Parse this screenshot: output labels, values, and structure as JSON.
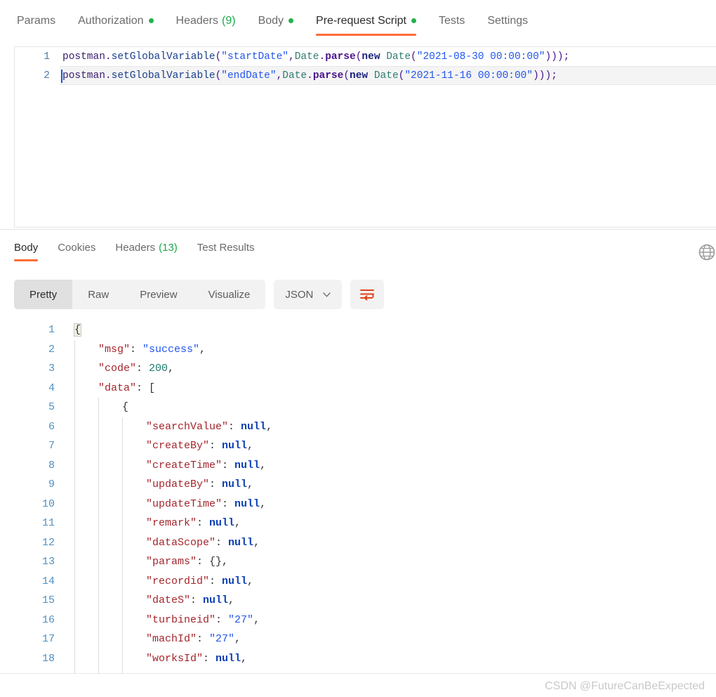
{
  "request_tabs": [
    {
      "label": "Params",
      "active": false,
      "dot": false,
      "count": null
    },
    {
      "label": "Authorization",
      "active": false,
      "dot": true,
      "count": null
    },
    {
      "label": "Headers",
      "active": false,
      "dot": false,
      "count": "(9)"
    },
    {
      "label": "Body",
      "active": false,
      "dot": true,
      "count": null
    },
    {
      "label": "Pre-request Script",
      "active": true,
      "dot": true,
      "count": null
    },
    {
      "label": "Tests",
      "active": false,
      "dot": false,
      "count": null
    },
    {
      "label": "Settings",
      "active": false,
      "dot": false,
      "count": null
    }
  ],
  "editor": {
    "lines": [
      {
        "number": "1",
        "active": false,
        "tokens": [
          {
            "t": "postman",
            "c": "js-obj"
          },
          {
            "t": ".",
            "c": "js-punct"
          },
          {
            "t": "setGlobalVariable",
            "c": "js-prop"
          },
          {
            "t": "(",
            "c": "js-punct"
          },
          {
            "t": "\"startDate\"",
            "c": "js-str"
          },
          {
            "t": ",",
            "c": "js-punct"
          },
          {
            "t": "Date",
            "c": "js-cls"
          },
          {
            "t": ".",
            "c": "js-punct"
          },
          {
            "t": "parse",
            "c": "js-meth"
          },
          {
            "t": "(",
            "c": "js-punct"
          },
          {
            "t": "new",
            "c": "js-kw"
          },
          {
            "t": " ",
            "c": "js-plain"
          },
          {
            "t": "Date",
            "c": "js-cls"
          },
          {
            "t": "(",
            "c": "js-punct"
          },
          {
            "t": "\"2021-08-30 00:00:00\"",
            "c": "js-str"
          },
          {
            "t": ")));",
            "c": "js-punct"
          }
        ]
      },
      {
        "number": "2",
        "active": true,
        "tokens": [
          {
            "t": "postman",
            "c": "js-obj"
          },
          {
            "t": ".",
            "c": "js-punct"
          },
          {
            "t": "setGlobalVariable",
            "c": "js-prop"
          },
          {
            "t": "(",
            "c": "js-punct"
          },
          {
            "t": "\"endDate\"",
            "c": "js-str"
          },
          {
            "t": ",",
            "c": "js-punct"
          },
          {
            "t": "Date",
            "c": "js-cls"
          },
          {
            "t": ".",
            "c": "js-punct"
          },
          {
            "t": "parse",
            "c": "js-meth"
          },
          {
            "t": "(",
            "c": "js-punct"
          },
          {
            "t": "new",
            "c": "js-kw"
          },
          {
            "t": " ",
            "c": "js-plain"
          },
          {
            "t": "Date",
            "c": "js-cls"
          },
          {
            "t": "(",
            "c": "js-punct"
          },
          {
            "t": "\"2021-11-16 00:00:00\"",
            "c": "js-str"
          },
          {
            "t": ")));",
            "c": "js-punct"
          }
        ]
      }
    ]
  },
  "response_tabs": [
    {
      "label": "Body",
      "active": true,
      "count": null
    },
    {
      "label": "Cookies",
      "active": false,
      "count": null
    },
    {
      "label": "Headers",
      "active": false,
      "count": "(13)"
    },
    {
      "label": "Test Results",
      "active": false,
      "count": null
    }
  ],
  "format_toolbar": {
    "segments": [
      {
        "label": "Pretty",
        "active": true
      },
      {
        "label": "Raw",
        "active": false
      },
      {
        "label": "Preview",
        "active": false
      },
      {
        "label": "Visualize",
        "active": false
      }
    ],
    "format_select": "JSON",
    "wrap_icon": "wrap-text-icon",
    "globe_icon": "globe-icon"
  },
  "response_body": {
    "lines": [
      {
        "number": "1",
        "indent": 0,
        "tokens": [
          {
            "t": "{",
            "c": "j-brace-hl"
          }
        ]
      },
      {
        "number": "2",
        "indent": 1,
        "tokens": [
          {
            "t": "\"msg\"",
            "c": "j-key"
          },
          {
            "t": ": ",
            "c": "j-punct"
          },
          {
            "t": "\"success\"",
            "c": "j-str"
          },
          {
            "t": ",",
            "c": "j-punct"
          }
        ]
      },
      {
        "number": "3",
        "indent": 1,
        "tokens": [
          {
            "t": "\"code\"",
            "c": "j-key"
          },
          {
            "t": ": ",
            "c": "j-punct"
          },
          {
            "t": "200",
            "c": "j-num"
          },
          {
            "t": ",",
            "c": "j-punct"
          }
        ]
      },
      {
        "number": "4",
        "indent": 1,
        "tokens": [
          {
            "t": "\"data\"",
            "c": "j-key"
          },
          {
            "t": ": ",
            "c": "j-punct"
          },
          {
            "t": "[",
            "c": "j-punct"
          }
        ]
      },
      {
        "number": "5",
        "indent": 2,
        "tokens": [
          {
            "t": "{",
            "c": "j-punct"
          }
        ]
      },
      {
        "number": "6",
        "indent": 3,
        "tokens": [
          {
            "t": "\"searchValue\"",
            "c": "j-key"
          },
          {
            "t": ": ",
            "c": "j-punct"
          },
          {
            "t": "null",
            "c": "j-null"
          },
          {
            "t": ",",
            "c": "j-punct"
          }
        ]
      },
      {
        "number": "7",
        "indent": 3,
        "tokens": [
          {
            "t": "\"createBy\"",
            "c": "j-key"
          },
          {
            "t": ": ",
            "c": "j-punct"
          },
          {
            "t": "null",
            "c": "j-null"
          },
          {
            "t": ",",
            "c": "j-punct"
          }
        ]
      },
      {
        "number": "8",
        "indent": 3,
        "tokens": [
          {
            "t": "\"createTime\"",
            "c": "j-key"
          },
          {
            "t": ": ",
            "c": "j-punct"
          },
          {
            "t": "null",
            "c": "j-null"
          },
          {
            "t": ",",
            "c": "j-punct"
          }
        ]
      },
      {
        "number": "9",
        "indent": 3,
        "tokens": [
          {
            "t": "\"updateBy\"",
            "c": "j-key"
          },
          {
            "t": ": ",
            "c": "j-punct"
          },
          {
            "t": "null",
            "c": "j-null"
          },
          {
            "t": ",",
            "c": "j-punct"
          }
        ]
      },
      {
        "number": "10",
        "indent": 3,
        "tokens": [
          {
            "t": "\"updateTime\"",
            "c": "j-key"
          },
          {
            "t": ": ",
            "c": "j-punct"
          },
          {
            "t": "null",
            "c": "j-null"
          },
          {
            "t": ",",
            "c": "j-punct"
          }
        ]
      },
      {
        "number": "11",
        "indent": 3,
        "tokens": [
          {
            "t": "\"remark\"",
            "c": "j-key"
          },
          {
            "t": ": ",
            "c": "j-punct"
          },
          {
            "t": "null",
            "c": "j-null"
          },
          {
            "t": ",",
            "c": "j-punct"
          }
        ]
      },
      {
        "number": "12",
        "indent": 3,
        "tokens": [
          {
            "t": "\"dataScope\"",
            "c": "j-key"
          },
          {
            "t": ": ",
            "c": "j-punct"
          },
          {
            "t": "null",
            "c": "j-null"
          },
          {
            "t": ",",
            "c": "j-punct"
          }
        ]
      },
      {
        "number": "13",
        "indent": 3,
        "tokens": [
          {
            "t": "\"params\"",
            "c": "j-key"
          },
          {
            "t": ": ",
            "c": "j-punct"
          },
          {
            "t": "{}",
            "c": "j-punct"
          },
          {
            "t": ",",
            "c": "j-punct"
          }
        ]
      },
      {
        "number": "14",
        "indent": 3,
        "tokens": [
          {
            "t": "\"recordid\"",
            "c": "j-key"
          },
          {
            "t": ": ",
            "c": "j-punct"
          },
          {
            "t": "null",
            "c": "j-null"
          },
          {
            "t": ",",
            "c": "j-punct"
          }
        ]
      },
      {
        "number": "15",
        "indent": 3,
        "tokens": [
          {
            "t": "\"dateS\"",
            "c": "j-key"
          },
          {
            "t": ": ",
            "c": "j-punct"
          },
          {
            "t": "null",
            "c": "j-null"
          },
          {
            "t": ",",
            "c": "j-punct"
          }
        ]
      },
      {
        "number": "16",
        "indent": 3,
        "tokens": [
          {
            "t": "\"turbineid\"",
            "c": "j-key"
          },
          {
            "t": ": ",
            "c": "j-punct"
          },
          {
            "t": "\"27\"",
            "c": "j-str"
          },
          {
            "t": ",",
            "c": "j-punct"
          }
        ]
      },
      {
        "number": "17",
        "indent": 3,
        "tokens": [
          {
            "t": "\"machId\"",
            "c": "j-key"
          },
          {
            "t": ": ",
            "c": "j-punct"
          },
          {
            "t": "\"27\"",
            "c": "j-str"
          },
          {
            "t": ",",
            "c": "j-punct"
          }
        ]
      },
      {
        "number": "18",
        "indent": 3,
        "tokens": [
          {
            "t": "\"worksId\"",
            "c": "j-key"
          },
          {
            "t": ": ",
            "c": "j-punct"
          },
          {
            "t": "null",
            "c": "j-null"
          },
          {
            "t": ",",
            "c": "j-punct"
          }
        ]
      }
    ]
  },
  "watermark": "CSDN @FutureCanBeExpected",
  "colors": {
    "accent": "#FF6C37",
    "dot_green": "#23B14D",
    "count_green": "#1BA94C",
    "json_key": "#A3262C",
    "json_string": "#2255EE",
    "json_number": "#1C7D6B",
    "json_null": "#0B40B5",
    "line_number": "#4E90C0"
  }
}
